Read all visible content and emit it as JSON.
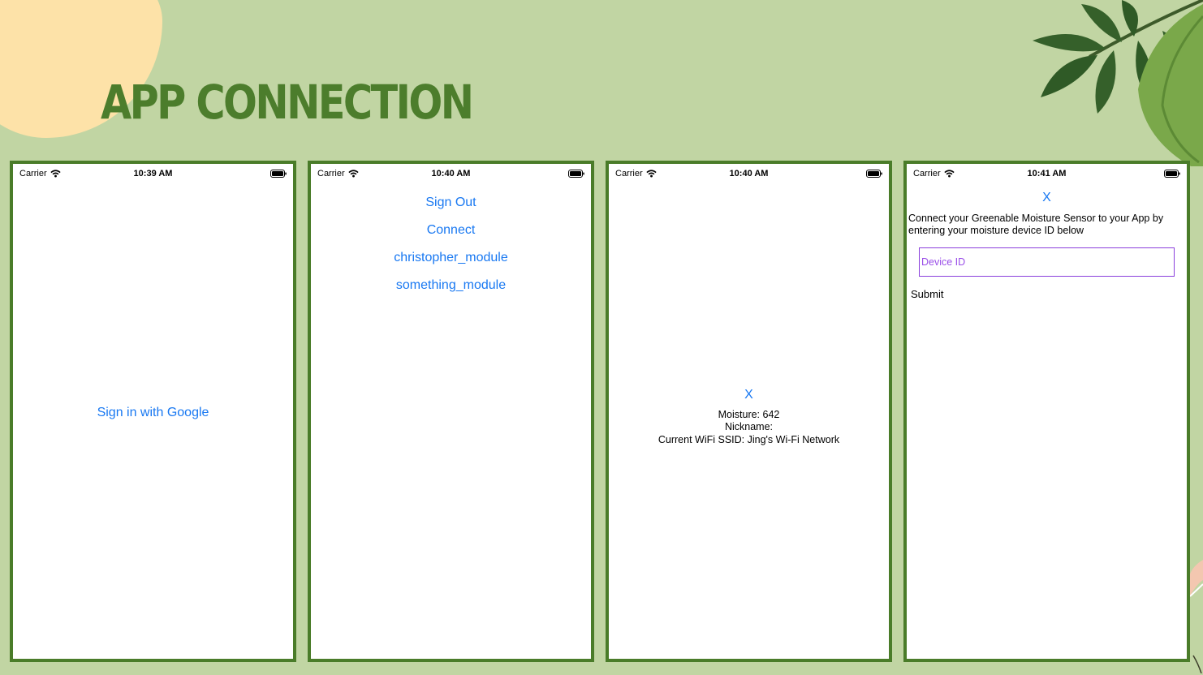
{
  "slide": {
    "title": "APP CONNECTION"
  },
  "colors": {
    "background": "#c1d5a3",
    "title": "#4c7d2c",
    "phone_border": "#4a7c29",
    "link_blue": "#1878f2",
    "input_purple": "#9a4ee8"
  },
  "screens": [
    {
      "carrier": "Carrier",
      "time": "10:39 AM",
      "sign_in_label": "Sign in with Google"
    },
    {
      "carrier": "Carrier",
      "time": "10:40 AM",
      "menu_items": [
        "Sign Out",
        "Connect",
        "christopher_module",
        "something_module"
      ]
    },
    {
      "carrier": "Carrier",
      "time": "10:40 AM",
      "close_label": "X",
      "moisture": "Moisture: 642",
      "nickname": "Nickname:",
      "wifi_ssid": "Current WiFi SSID: Jing's Wi-Fi Network"
    },
    {
      "carrier": "Carrier",
      "time": "10:41 AM",
      "close_label": "X",
      "instructions": "Connect your Greenable Moisture Sensor to your App by entering your moisture device ID below",
      "device_id_placeholder": "Device ID",
      "submit_label": "Submit"
    }
  ],
  "icons": [
    "wifi-icon",
    "battery-icon"
  ]
}
